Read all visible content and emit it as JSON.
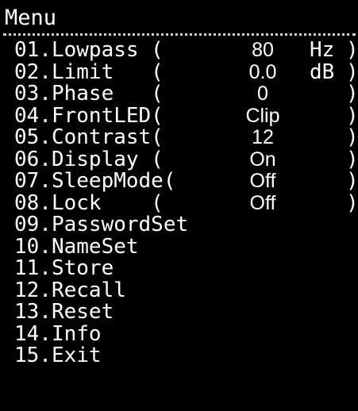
{
  "menu": {
    "title": "Menu",
    "items": [
      {
        "label": "01.Lowpass (",
        "value": "80",
        "unit": "Hz",
        "close": ")"
      },
      {
        "label": "02.Limit   (",
        "value": "0.0",
        "unit": "dB",
        "close": ")"
      },
      {
        "label": "03.Phase   (",
        "value": "0",
        "unit": "",
        "close": ")"
      },
      {
        "label": "04.FrontLED(",
        "value": "Clip",
        "unit": "",
        "close": ")"
      },
      {
        "label": "05.Contrast(",
        "value": "12",
        "unit": "",
        "close": ")"
      },
      {
        "label": "06.Display (",
        "value": "On",
        "unit": "",
        "close": ")"
      },
      {
        "label": "07.SleepMode(",
        "value": "Off",
        "unit": "",
        "close": ")"
      },
      {
        "label": "08.Lock    (",
        "value": "Off",
        "unit": "",
        "close": ")"
      },
      {
        "label": "09.PasswordSet"
      },
      {
        "label": "10.NameSet"
      },
      {
        "label": "11.Store"
      },
      {
        "label": "12.Recall"
      },
      {
        "label": "13.Reset"
      },
      {
        "label": "14.Info"
      },
      {
        "label": "15.Exit"
      }
    ]
  }
}
